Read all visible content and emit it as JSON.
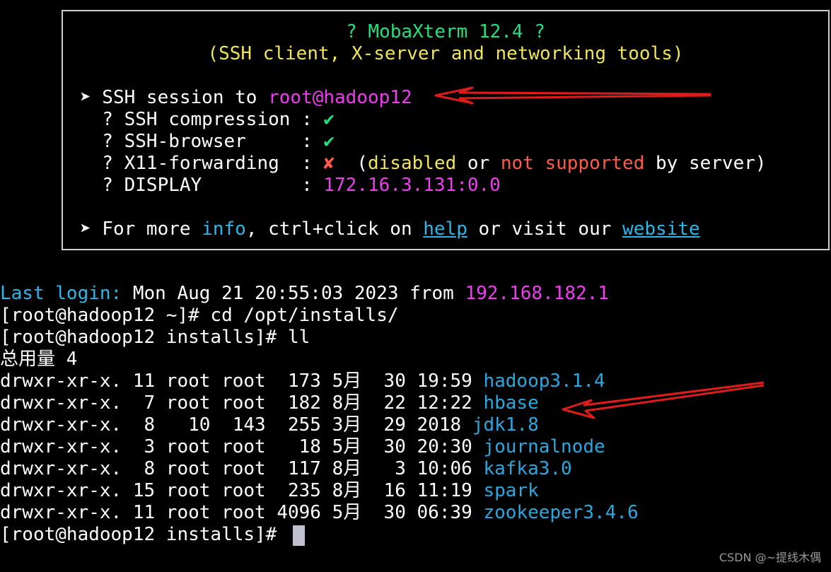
{
  "banner": {
    "title": "? MobaXterm 12.4 ?",
    "subtitle": "(SSH client, X-server and networking tools)",
    "ssh_prefix": "➤ SSH session to ",
    "ssh_target": "root@hadoop12",
    "compression_label": "  ? SSH compression : ",
    "compression_status": "✔",
    "browser_label": "  ? SSH-browser     : ",
    "browser_status": "✔",
    "x11_label": "  ? X11-forwarding  : ",
    "x11_status": "✘",
    "x11_note_open": "  (",
    "x11_disabled": "disabled",
    "x11_or": " or ",
    "x11_not_supported": "not supported",
    "x11_by_server": " by server)",
    "display_label": "  ? DISPLAY         : ",
    "display_value": "172.16.3.131:0.0",
    "more_prefix": "➤ For more ",
    "more_info": "info",
    "more_mid": ", ctrl+click on ",
    "more_help": "help",
    "more_or": " or visit our ",
    "more_website": "website"
  },
  "session": {
    "last_login_label": "Last login:",
    "last_login_value": " Mon Aug 21 20:55:03 2023 from ",
    "last_login_ip": "192.168.182.1",
    "cmd1": "[root@hadoop12 ~]# cd /opt/installs/",
    "cmd2": "[root@hadoop12 installs]# ll",
    "total": "总用量 4",
    "prompt": "[root@hadoop12 installs]# "
  },
  "listing": [
    {
      "meta": "drwxr-xr-x. 11 root root  173 5月  30 19:59 ",
      "name": "hadoop3.1.4"
    },
    {
      "meta": "drwxr-xr-x.  7 root root  182 8月  22 12:22 ",
      "name": "hbase"
    },
    {
      "meta": "drwxr-xr-x.  8   10  143  255 3月  29 2018 ",
      "name": "jdk1.8"
    },
    {
      "meta": "drwxr-xr-x.  3 root root   18 5月  30 20:30 ",
      "name": "journalnode"
    },
    {
      "meta": "drwxr-xr-x.  8 root root  117 8月   3 10:06 ",
      "name": "kafka3.0"
    },
    {
      "meta": "drwxr-xr-x. 15 root root  235 8月  16 11:19 ",
      "name": "spark"
    },
    {
      "meta": "drwxr-xr-x. 11 root root 4096 5月  30 06:39 ",
      "name": "zookeeper3.4.6"
    }
  ],
  "watermark": "CSDN @~提线木偶",
  "colors": {
    "background": "#000000",
    "title_green": "#22e07a",
    "subtitle_yellow": "#f0e45a",
    "host_magenta": "#f03cf0",
    "link_cyan": "#2fb6e8",
    "error_red": "#ff5a4a",
    "annotation_arrow": "#e01b1b"
  }
}
